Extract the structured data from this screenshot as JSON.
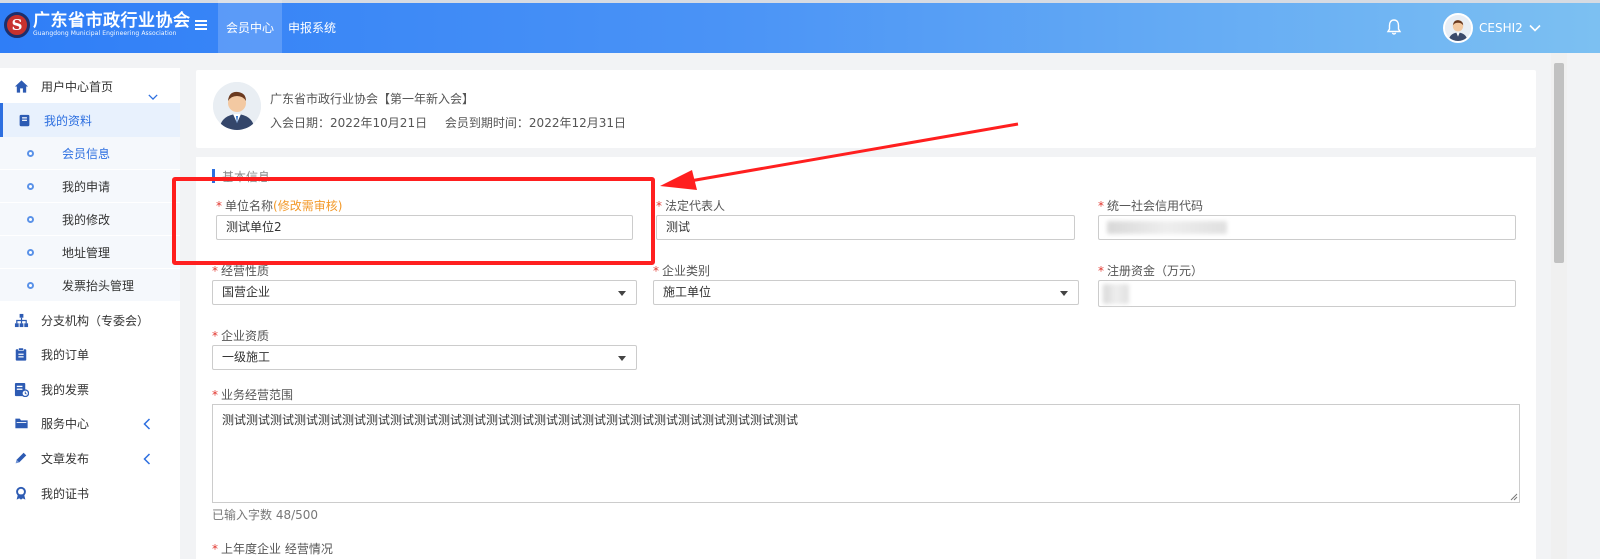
{
  "header": {
    "logo_cn": "广东省市政行业协会",
    "logo_en": "Guangdong Municipal Engineering Association",
    "logo_letter": "S",
    "nav": [
      "会员中心",
      "申报系统"
    ],
    "active_nav": "会员中心",
    "user_name": "CESHI2"
  },
  "sidebar": {
    "items": [
      {
        "label": "用户中心首页",
        "icon": "home-icon"
      },
      {
        "label": "我的资料",
        "icon": "profile-icon"
      },
      {
        "label": "分支机构（专委会）",
        "icon": "org-chart-icon"
      },
      {
        "label": "我的订单",
        "icon": "clipboard-icon"
      },
      {
        "label": "我的发票",
        "icon": "invoice-icon"
      },
      {
        "label": "服务中心",
        "icon": "folder-icon"
      },
      {
        "label": "文章发布",
        "icon": "pencil-icon"
      },
      {
        "label": "我的证书",
        "icon": "certificate-icon"
      }
    ],
    "sub_items": [
      "会员信息",
      "我的申请",
      "我的修改",
      "地址管理",
      "发票抬头管理"
    ]
  },
  "profile": {
    "org_name": "广东省市政行业协会【第一年新入会】",
    "join_date": "入会日期：2022年10月21日",
    "expire_date": "会员到期时间：2022年12月31日"
  },
  "form": {
    "section_title": "基本信息",
    "unit_name_label": "单位名称",
    "unit_name_note": "(修改需审核)",
    "unit_name_value": "测试单位2",
    "legal_rep_label": "法定代表人",
    "legal_rep_value": "测试",
    "credit_code_label": "统一社会信用代码",
    "nature_label": "经营性质",
    "nature_value": "国营企业",
    "category_label": "企业类别",
    "category_value": "施工单位",
    "capital_label": "注册资金（万元）",
    "qualification_label": "企业资质",
    "qualification_value": "一级施工",
    "scope_label": "业务经营范围",
    "scope_value": "测试测试测试测试测试测试测试测试测试测试测试测试测试测试测试测试测试测试测试测试测试测试测试测试",
    "char_count": "已输入字数 48/500",
    "last_year_label": "上年度企业 经营情况"
  },
  "colors": {
    "accent": "#2d6fe0",
    "required": "#e2372f",
    "note": "#f39a2b",
    "annotation": "#ff1f1f"
  }
}
